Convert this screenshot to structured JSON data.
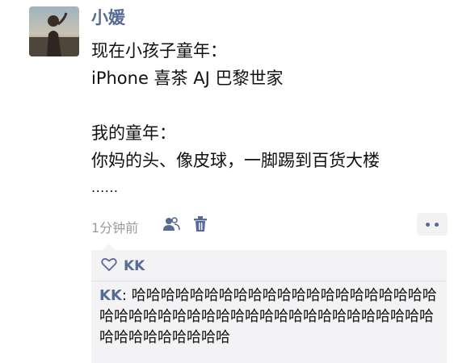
{
  "post": {
    "author": "小媛",
    "lines": [
      "现在小孩子童年：",
      "iPhone 喜茶 AJ 巴黎世家",
      "",
      "我的童年：",
      "你妈的头、像皮球，一脚踢到百货大楼",
      "......"
    ],
    "time": "1分钟前"
  },
  "icons": {
    "privacy": "people-icon",
    "delete": "trash-icon",
    "more": "more-dots-icon",
    "like": "heart-outline-icon"
  },
  "likes": {
    "users": "KK"
  },
  "comment": {
    "author": "KK",
    "separator": ": ",
    "text": "哈哈哈哈哈哈哈哈哈哈哈哈哈哈哈哈哈哈哈哈哈哈哈哈哈哈哈哈哈哈哈哈哈哈哈哈哈哈哈哈哈哈哈哈哈哈哈哈哈哈哈哈哈"
  },
  "colors": {
    "link": "#576b95",
    "text": "#111111",
    "meta": "#9a9a9a",
    "panel": "#f3f3f5"
  }
}
